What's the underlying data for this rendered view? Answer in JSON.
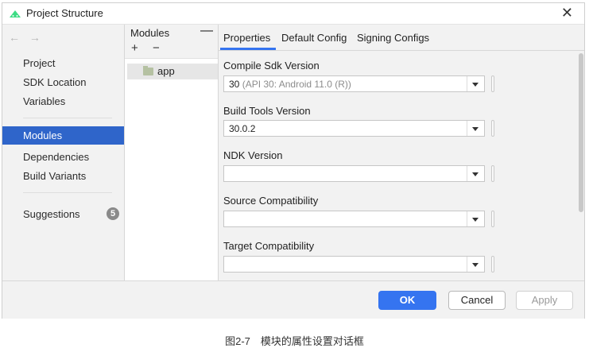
{
  "window": {
    "title": "Project Structure",
    "close_glyph": "✕"
  },
  "nav": {
    "back_glyph": "←",
    "forward_glyph": "→",
    "group1": [
      "Project",
      "SDK Location",
      "Variables"
    ],
    "selected": "Modules",
    "group2": [
      "Dependencies",
      "Build Variants"
    ],
    "suggestions_label": "Suggestions",
    "suggestions_count": "5"
  },
  "modules": {
    "header": "Modules",
    "collapse_glyph": "—",
    "add_glyph": "+",
    "remove_glyph": "−",
    "items": [
      "app"
    ]
  },
  "tabs": [
    "Properties",
    "Default Config",
    "Signing Configs"
  ],
  "fields": [
    {
      "label": "Compile Sdk Version",
      "value": "30",
      "hint": "(API 30: Android 11.0 (R))"
    },
    {
      "label": "Build Tools Version",
      "value": "30.0.2",
      "hint": ""
    },
    {
      "label": "NDK Version",
      "value": "",
      "hint": ""
    },
    {
      "label": "Source Compatibility",
      "value": "",
      "hint": ""
    },
    {
      "label": "Target Compatibility",
      "value": "",
      "hint": ""
    }
  ],
  "buttons": {
    "ok": "OK",
    "cancel": "Cancel",
    "apply": "Apply"
  },
  "caption": "图2-7　模块的属性设置对话框",
  "colors": {
    "accent": "#3574f0",
    "selection": "#2f65ca",
    "logo": "#3ddc84"
  }
}
